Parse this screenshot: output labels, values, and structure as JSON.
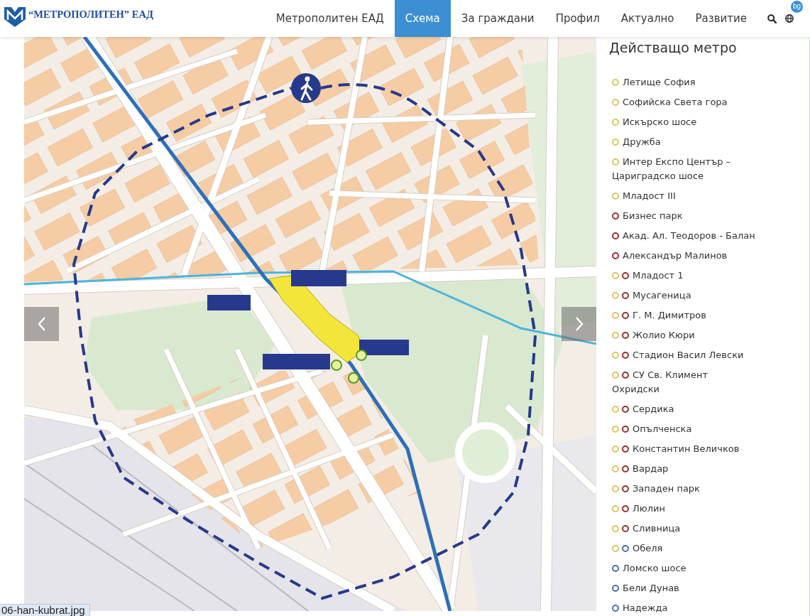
{
  "header": {
    "logo_text": "“МЕТРОПОЛИТЕН” ЕАД",
    "nav": [
      {
        "label": "Метрополитен ЕАД",
        "selected": false
      },
      {
        "label": "Схема",
        "selected": true
      },
      {
        "label": "За граждани",
        "selected": false
      },
      {
        "label": "Профил",
        "selected": false
      },
      {
        "label": "Актуално",
        "selected": false
      },
      {
        "label": "Развитие",
        "selected": false
      }
    ],
    "language_badge": "bg"
  },
  "sidebar": {
    "title": "Действащо метро",
    "stations": [
      {
        "name": "Летище София",
        "lines": [
          {
            "color": "#d8c766"
          }
        ]
      },
      {
        "name": "Софийска Света гора",
        "lines": [
          {
            "color": "#d8c766"
          }
        ]
      },
      {
        "name": "Искърско шосе",
        "lines": [
          {
            "color": "#d8c766"
          }
        ]
      },
      {
        "name": "Дружба",
        "lines": [
          {
            "color": "#d8c766"
          }
        ]
      },
      {
        "name": "Интер Експо Център – Цариградско шосе",
        "lines": [
          {
            "color": "#d8c766"
          }
        ]
      },
      {
        "name": "Младост III",
        "lines": [
          {
            "color": "#d8c766"
          }
        ]
      },
      {
        "name": "Бизнес парк",
        "lines": [
          {
            "color": "#992e2e"
          }
        ]
      },
      {
        "name": "Акад. Ал. Теодоров - Балан",
        "lines": [
          {
            "color": "#992e2e"
          }
        ]
      },
      {
        "name": "Александър Малинов",
        "lines": [
          {
            "color": "#992e2e"
          }
        ]
      },
      {
        "name": "Младост 1",
        "lines": [
          {
            "color": "#d8c766"
          },
          {
            "color": "#992e2e"
          }
        ]
      },
      {
        "name": "Мусагеница",
        "lines": [
          {
            "color": "#d8c766"
          },
          {
            "color": "#992e2e"
          }
        ]
      },
      {
        "name": "Г. М. Димитров",
        "lines": [
          {
            "color": "#d8c766"
          },
          {
            "color": "#992e2e"
          }
        ]
      },
      {
        "name": "Жолио Кюри",
        "lines": [
          {
            "color": "#d8c766"
          },
          {
            "color": "#992e2e"
          }
        ]
      },
      {
        "name": "Стадион Васил Левски",
        "lines": [
          {
            "color": "#d8c766"
          },
          {
            "color": "#992e2e"
          }
        ]
      },
      {
        "name": "СУ Св. Климент Охридски",
        "lines": [
          {
            "color": "#d8c766"
          },
          {
            "color": "#992e2e"
          }
        ]
      },
      {
        "name": "Сердика",
        "lines": [
          {
            "color": "#d8c766"
          },
          {
            "color": "#992e2e"
          }
        ]
      },
      {
        "name": "Опълченска",
        "lines": [
          {
            "color": "#d8c766"
          },
          {
            "color": "#992e2e"
          }
        ]
      },
      {
        "name": "Константин Величков",
        "lines": [
          {
            "color": "#d8c766"
          },
          {
            "color": "#992e2e"
          }
        ]
      },
      {
        "name": "Вардар",
        "lines": [
          {
            "color": "#d8c766"
          },
          {
            "color": "#992e2e"
          }
        ]
      },
      {
        "name": "Западен парк",
        "lines": [
          {
            "color": "#d8c766"
          },
          {
            "color": "#992e2e"
          }
        ]
      },
      {
        "name": "Люлин",
        "lines": [
          {
            "color": "#d8c766"
          },
          {
            "color": "#992e2e"
          }
        ]
      },
      {
        "name": "Сливница",
        "lines": [
          {
            "color": "#d8c766"
          },
          {
            "color": "#992e2e"
          }
        ]
      },
      {
        "name": "Обеля",
        "lines": [
          {
            "color": "#d8c766"
          },
          {
            "color": "#4a6fb0"
          }
        ]
      },
      {
        "name": "Ломско шосе",
        "lines": [
          {
            "color": "#4a6fb0"
          }
        ]
      },
      {
        "name": "Бели Дунав",
        "lines": [
          {
            "color": "#4a6fb0"
          }
        ]
      },
      {
        "name": "Надежда",
        "lines": [
          {
            "color": "#4a6fb0"
          }
        ]
      }
    ]
  },
  "status_bar": {
    "url": "06-han-kubrat.jpg"
  }
}
